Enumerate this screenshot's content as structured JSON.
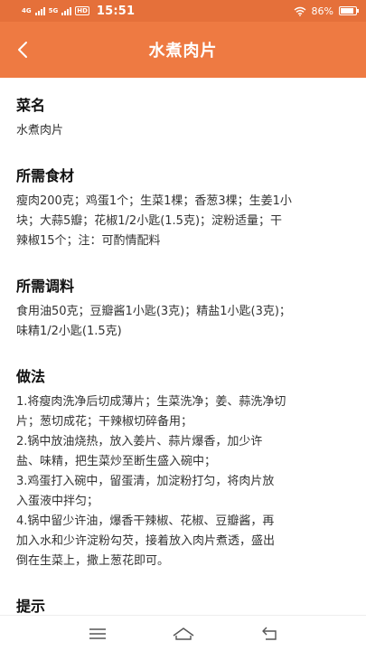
{
  "status_bar": {
    "network_top": "4G",
    "network_top2": "5G",
    "hd_badge": "HD",
    "time": "15:51",
    "battery_percent": "86%",
    "battery_level": 0.86,
    "icons": [
      "signal-icon",
      "wifi-icon",
      "battery-icon"
    ]
  },
  "header": {
    "title": "水煮肉片",
    "back_icon": "back-arrow-icon",
    "background_color": "#ee7a42"
  },
  "sections": [
    {
      "title": "菜名",
      "lines": [
        "水煮肉片"
      ]
    },
    {
      "title": "所需食材",
      "lines": [
        "瘦肉200克；鸡蛋1个；生菜1棵；香葱3棵；生姜1小",
        "块；大蒜5瓣；花椒1/2小匙(1.5克)；淀粉适量；干",
        "辣椒15个；注：可酌情配料"
      ]
    },
    {
      "title": "所需调料",
      "lines": [
        "食用油50克；豆瓣酱1小匙(3克)；精盐1小匙(3克)；",
        "味精1/2小匙(1.5克)"
      ]
    },
    {
      "title": "做法",
      "lines": [
        "1.将瘦肉洗净后切成薄片；生菜洗净；姜、蒜洗净切",
        "片；葱切成花；干辣椒切碎备用；",
        "2.锅中放油烧热，放入姜片、蒜片爆香，加少许",
        "盐、味精，把生菜炒至断生盛入碗中；",
        "3.鸡蛋打入碗中，留蛋清，加淀粉打匀，将肉片放",
        "入蛋液中拌匀；",
        "4.锅中留少许油，爆香干辣椒、花椒、豆瓣酱，再",
        "加入水和少许淀粉勾芡，接着放入肉片煮透，盛出",
        "倒在生菜上，撒上葱花即可。"
      ]
    },
    {
      "title": "提示",
      "lines": []
    }
  ],
  "nav_bar": {
    "icons": [
      "menu-icon",
      "home-icon",
      "back-icon"
    ]
  }
}
